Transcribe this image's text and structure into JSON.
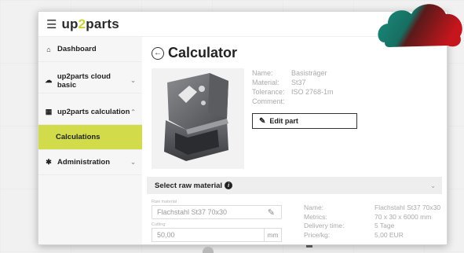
{
  "topbar": {
    "menu_icon": "hamburger-icon",
    "logo_prefix": "up",
    "logo_accent": "2",
    "logo_suffix": "parts"
  },
  "sidebar": {
    "items": [
      {
        "label": "Dashboard",
        "icon": "home-icon"
      },
      {
        "label": "up2parts cloud basic",
        "icon": "cloud-icon",
        "chevron": "chevron-down-icon"
      },
      {
        "label": "up2parts calculation",
        "icon": "calculator-icon",
        "chevron": "chevron-up-icon"
      },
      {
        "label": "Calculations",
        "active": true
      },
      {
        "label": "Administration",
        "icon": "gear-icon",
        "chevron": "chevron-down-icon"
      }
    ]
  },
  "main": {
    "title": "Calculator",
    "details": [
      {
        "key": "Name:",
        "value": "Basisträger"
      },
      {
        "key": "Material:",
        "value": "St37"
      },
      {
        "key": "Tolerance:",
        "value": "ISO 2768-1m"
      },
      {
        "key": "Comment:",
        "value": ""
      }
    ],
    "edit_button": "Edit part",
    "raw_material_title": "Select raw material",
    "raw_material_label": "Raw material",
    "raw_material_value": "Flachstahl St37 70x30",
    "cutting_label": "Cutting",
    "cutting_value": "50,00",
    "cutting_unit": "mm",
    "material_details": [
      {
        "key": "Name:",
        "value": "Flachstahl St37 70x30"
      },
      {
        "key": "Metrics:",
        "value": "70 x 30 x 6000 mm"
      },
      {
        "key": "Delivery time:",
        "value": "5 Tage"
      },
      {
        "key": "Price/kg:",
        "value": "5,00 EUR"
      }
    ]
  },
  "colors": {
    "accent": "#d2dc4a",
    "cloud_teal": "#1a8f7e",
    "cloud_red": "#c4161c"
  }
}
